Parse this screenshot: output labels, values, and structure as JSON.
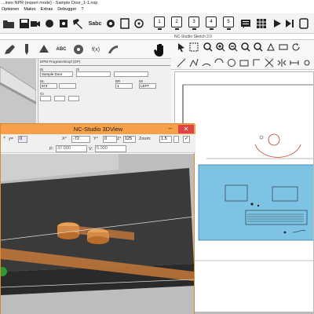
{
  "app": {
    "title": "...ineo NPR (expert mode) - Sample Door_1-1.nsp",
    "menu": [
      "Optionen",
      "Makro",
      "Extras",
      "Debugger",
      "?"
    ]
  },
  "toolbar": {
    "sabc_label": "Sabc",
    "screens": [
      "1",
      "2",
      "3",
      "4",
      "5"
    ]
  },
  "left_panel": {
    "header": "",
    "tools": [
      "ABC",
      "f(x)"
    ],
    "dpm": {
      "title": "DPM Programmkopf (DP)",
      "fields": [
        {
          "label": "Bi",
          "value": "Sample Door"
        },
        {
          "label": "Di",
          "value": ""
        },
        {
          "label": "DL",
          "value": "974"
        },
        {
          "label": "BR",
          "value": "1"
        },
        {
          "label": "MI",
          "value": "LEFT"
        },
        {
          "label": "GI",
          "value": ""
        }
      ]
    }
  },
  "right_panel": {
    "header": "NC-Studio Sketch 2.0"
  },
  "view3d": {
    "title": "NC-Studio 3DView",
    "fields": {
      "y_label": "y=",
      "y_value": "0",
      "x_label": "X°",
      "x_value": "-72",
      "y2_label": "Y°",
      "y2_value": "0",
      "z_label": "Z°",
      "z_value": "125",
      "zoom_label": "Zoom:",
      "zoom_value": "1.5",
      "p_label": "P:",
      "p_value": "37.000",
      "v_label": "V:",
      "v_value": "5.000"
    }
  },
  "colors": {
    "accent_orange": "#f6a049",
    "close_red": "#e04343",
    "cad_blue": "#7dc4e4",
    "wood": "#c5783a"
  }
}
